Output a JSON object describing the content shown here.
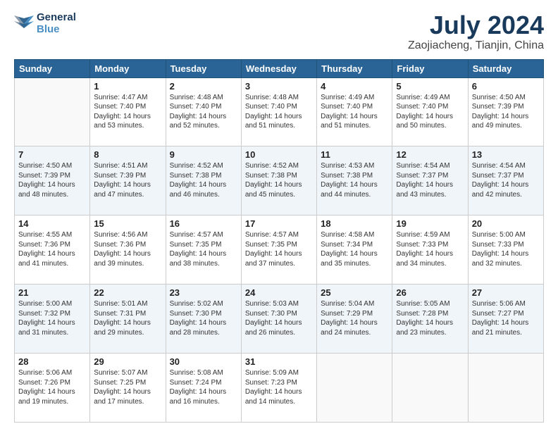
{
  "header": {
    "logo_line1": "General",
    "logo_line2": "Blue",
    "month_title": "July 2024",
    "location": "Zaojiacheng, Tianjin, China"
  },
  "days_of_week": [
    "Sunday",
    "Monday",
    "Tuesday",
    "Wednesday",
    "Thursday",
    "Friday",
    "Saturday"
  ],
  "weeks": [
    [
      {
        "day": "",
        "sunrise": "",
        "sunset": "",
        "daylight": ""
      },
      {
        "day": "1",
        "sunrise": "Sunrise: 4:47 AM",
        "sunset": "Sunset: 7:40 PM",
        "daylight": "Daylight: 14 hours and 53 minutes."
      },
      {
        "day": "2",
        "sunrise": "Sunrise: 4:48 AM",
        "sunset": "Sunset: 7:40 PM",
        "daylight": "Daylight: 14 hours and 52 minutes."
      },
      {
        "day": "3",
        "sunrise": "Sunrise: 4:48 AM",
        "sunset": "Sunset: 7:40 PM",
        "daylight": "Daylight: 14 hours and 51 minutes."
      },
      {
        "day": "4",
        "sunrise": "Sunrise: 4:49 AM",
        "sunset": "Sunset: 7:40 PM",
        "daylight": "Daylight: 14 hours and 51 minutes."
      },
      {
        "day": "5",
        "sunrise": "Sunrise: 4:49 AM",
        "sunset": "Sunset: 7:40 PM",
        "daylight": "Daylight: 14 hours and 50 minutes."
      },
      {
        "day": "6",
        "sunrise": "Sunrise: 4:50 AM",
        "sunset": "Sunset: 7:39 PM",
        "daylight": "Daylight: 14 hours and 49 minutes."
      }
    ],
    [
      {
        "day": "7",
        "sunrise": "Sunrise: 4:50 AM",
        "sunset": "Sunset: 7:39 PM",
        "daylight": "Daylight: 14 hours and 48 minutes."
      },
      {
        "day": "8",
        "sunrise": "Sunrise: 4:51 AM",
        "sunset": "Sunset: 7:39 PM",
        "daylight": "Daylight: 14 hours and 47 minutes."
      },
      {
        "day": "9",
        "sunrise": "Sunrise: 4:52 AM",
        "sunset": "Sunset: 7:38 PM",
        "daylight": "Daylight: 14 hours and 46 minutes."
      },
      {
        "day": "10",
        "sunrise": "Sunrise: 4:52 AM",
        "sunset": "Sunset: 7:38 PM",
        "daylight": "Daylight: 14 hours and 45 minutes."
      },
      {
        "day": "11",
        "sunrise": "Sunrise: 4:53 AM",
        "sunset": "Sunset: 7:38 PM",
        "daylight": "Daylight: 14 hours and 44 minutes."
      },
      {
        "day": "12",
        "sunrise": "Sunrise: 4:54 AM",
        "sunset": "Sunset: 7:37 PM",
        "daylight": "Daylight: 14 hours and 43 minutes."
      },
      {
        "day": "13",
        "sunrise": "Sunrise: 4:54 AM",
        "sunset": "Sunset: 7:37 PM",
        "daylight": "Daylight: 14 hours and 42 minutes."
      }
    ],
    [
      {
        "day": "14",
        "sunrise": "Sunrise: 4:55 AM",
        "sunset": "Sunset: 7:36 PM",
        "daylight": "Daylight: 14 hours and 41 minutes."
      },
      {
        "day": "15",
        "sunrise": "Sunrise: 4:56 AM",
        "sunset": "Sunset: 7:36 PM",
        "daylight": "Daylight: 14 hours and 39 minutes."
      },
      {
        "day": "16",
        "sunrise": "Sunrise: 4:57 AM",
        "sunset": "Sunset: 7:35 PM",
        "daylight": "Daylight: 14 hours and 38 minutes."
      },
      {
        "day": "17",
        "sunrise": "Sunrise: 4:57 AM",
        "sunset": "Sunset: 7:35 PM",
        "daylight": "Daylight: 14 hours and 37 minutes."
      },
      {
        "day": "18",
        "sunrise": "Sunrise: 4:58 AM",
        "sunset": "Sunset: 7:34 PM",
        "daylight": "Daylight: 14 hours and 35 minutes."
      },
      {
        "day": "19",
        "sunrise": "Sunrise: 4:59 AM",
        "sunset": "Sunset: 7:33 PM",
        "daylight": "Daylight: 14 hours and 34 minutes."
      },
      {
        "day": "20",
        "sunrise": "Sunrise: 5:00 AM",
        "sunset": "Sunset: 7:33 PM",
        "daylight": "Daylight: 14 hours and 32 minutes."
      }
    ],
    [
      {
        "day": "21",
        "sunrise": "Sunrise: 5:00 AM",
        "sunset": "Sunset: 7:32 PM",
        "daylight": "Daylight: 14 hours and 31 minutes."
      },
      {
        "day": "22",
        "sunrise": "Sunrise: 5:01 AM",
        "sunset": "Sunset: 7:31 PM",
        "daylight": "Daylight: 14 hours and 29 minutes."
      },
      {
        "day": "23",
        "sunrise": "Sunrise: 5:02 AM",
        "sunset": "Sunset: 7:30 PM",
        "daylight": "Daylight: 14 hours and 28 minutes."
      },
      {
        "day": "24",
        "sunrise": "Sunrise: 5:03 AM",
        "sunset": "Sunset: 7:30 PM",
        "daylight": "Daylight: 14 hours and 26 minutes."
      },
      {
        "day": "25",
        "sunrise": "Sunrise: 5:04 AM",
        "sunset": "Sunset: 7:29 PM",
        "daylight": "Daylight: 14 hours and 24 minutes."
      },
      {
        "day": "26",
        "sunrise": "Sunrise: 5:05 AM",
        "sunset": "Sunset: 7:28 PM",
        "daylight": "Daylight: 14 hours and 23 minutes."
      },
      {
        "day": "27",
        "sunrise": "Sunrise: 5:06 AM",
        "sunset": "Sunset: 7:27 PM",
        "daylight": "Daylight: 14 hours and 21 minutes."
      }
    ],
    [
      {
        "day": "28",
        "sunrise": "Sunrise: 5:06 AM",
        "sunset": "Sunset: 7:26 PM",
        "daylight": "Daylight: 14 hours and 19 minutes."
      },
      {
        "day": "29",
        "sunrise": "Sunrise: 5:07 AM",
        "sunset": "Sunset: 7:25 PM",
        "daylight": "Daylight: 14 hours and 17 minutes."
      },
      {
        "day": "30",
        "sunrise": "Sunrise: 5:08 AM",
        "sunset": "Sunset: 7:24 PM",
        "daylight": "Daylight: 14 hours and 16 minutes."
      },
      {
        "day": "31",
        "sunrise": "Sunrise: 5:09 AM",
        "sunset": "Sunset: 7:23 PM",
        "daylight": "Daylight: 14 hours and 14 minutes."
      },
      {
        "day": "",
        "sunrise": "",
        "sunset": "",
        "daylight": ""
      },
      {
        "day": "",
        "sunrise": "",
        "sunset": "",
        "daylight": ""
      },
      {
        "day": "",
        "sunrise": "",
        "sunset": "",
        "daylight": ""
      }
    ]
  ]
}
